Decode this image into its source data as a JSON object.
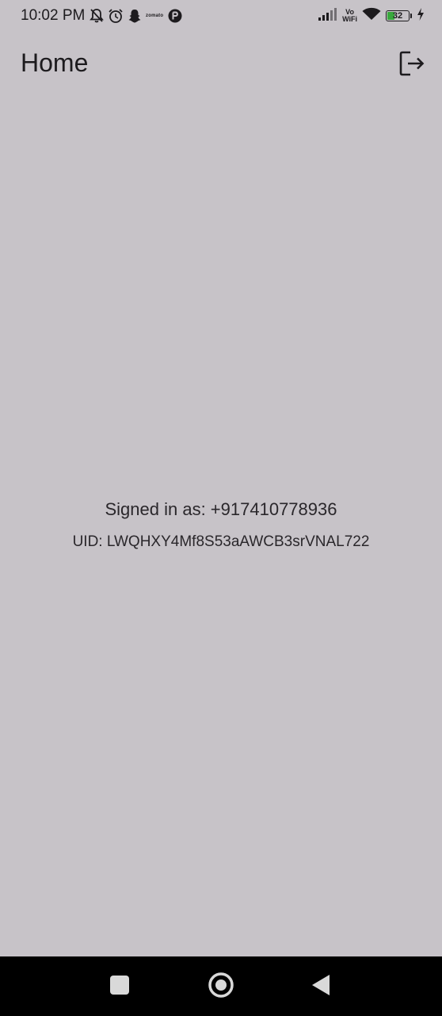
{
  "status_bar": {
    "time": "10:02 PM",
    "left_icons": [
      "bell-off-icon",
      "alarm-icon",
      "snapchat-icon",
      "zomato-icon",
      "app-notification-icon"
    ],
    "zomato_label": "zomato",
    "vowifi_top": "Vo",
    "vowifi_bottom": "WiFi",
    "battery_level": "32",
    "charging": true
  },
  "app_bar": {
    "title": "Home",
    "logout_icon": "logout-icon"
  },
  "main": {
    "signed_in_text": "Signed in as: +917410778936",
    "uid_text": "UID: LWQHXY4Mf8S53aAWCB3srVNAL722"
  },
  "colors": {
    "background": "#c7c3c8",
    "text": "#1d1b1e",
    "nav_bar": "#000000",
    "battery_fill": "#39a83d"
  },
  "nav_bar": {
    "icons": [
      "recents-square-icon",
      "home-circle-icon",
      "back-triangle-icon"
    ]
  }
}
